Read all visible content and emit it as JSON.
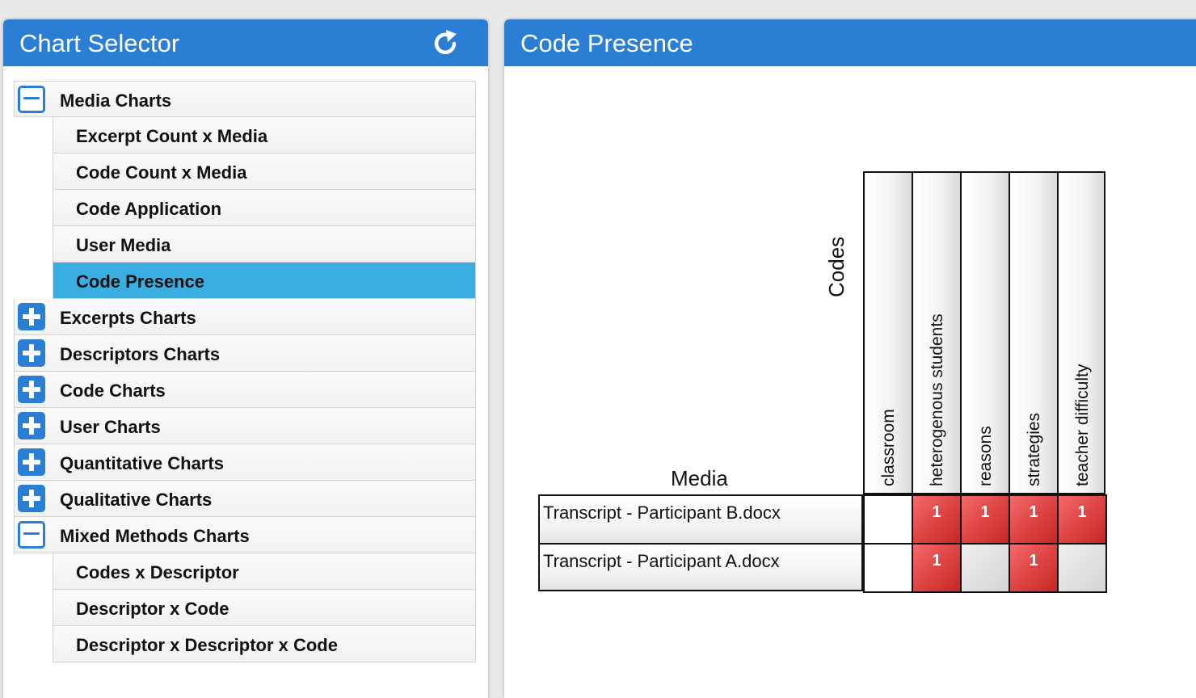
{
  "left_panel": {
    "title": "Chart Selector",
    "refresh_icon": "refresh-icon"
  },
  "tree": [
    {
      "label": "Media Charts",
      "level": 0,
      "toggle": "minus"
    },
    {
      "label": "Excerpt Count x Media",
      "level": 1
    },
    {
      "label": "Code Count x Media",
      "level": 1
    },
    {
      "label": "Code Application",
      "level": 1
    },
    {
      "label": "User Media",
      "level": 1
    },
    {
      "label": "Code Presence",
      "level": 1,
      "selected": true
    },
    {
      "label": "Excerpts Charts",
      "level": 0,
      "toggle": "plus"
    },
    {
      "label": "Descriptors Charts",
      "level": 0,
      "toggle": "plus"
    },
    {
      "label": "Code Charts",
      "level": 0,
      "toggle": "plus"
    },
    {
      "label": "User Charts",
      "level": 0,
      "toggle": "plus"
    },
    {
      "label": "Quantitative Charts",
      "level": 0,
      "toggle": "plus"
    },
    {
      "label": "Qualitative Charts",
      "level": 0,
      "toggle": "plus"
    },
    {
      "label": "Mixed Methods Charts",
      "level": 0,
      "toggle": "minus"
    },
    {
      "label": "Codes x Descriptor",
      "level": 1
    },
    {
      "label": "Descriptor x Code",
      "level": 1
    },
    {
      "label": "Descriptor x Descriptor x Code",
      "level": 1
    }
  ],
  "right_panel": {
    "title": "Code Presence"
  },
  "colors": {
    "header_blue": "#2a7fd4",
    "selected_row": "#3aaee0",
    "hot_cell": "#e04848"
  },
  "chart_data": {
    "type": "heatmap",
    "title": "",
    "xlabel": "Codes",
    "ylabel": "Media",
    "columns": [
      "classroom",
      "heterogenous students",
      "reasons",
      "strategies",
      "teacher difficulty"
    ],
    "rows": [
      "Transcript - Participant B.docx",
      "Transcript - Participant A.docx"
    ],
    "values": [
      [
        null,
        1,
        1,
        1,
        1
      ],
      [
        null,
        1,
        null,
        1,
        null
      ]
    ],
    "cell_styles": [
      [
        "empty",
        "hot",
        "hot",
        "hot",
        "hot"
      ],
      [
        "empty",
        "hot",
        "gray",
        "hot",
        "gray"
      ]
    ]
  }
}
